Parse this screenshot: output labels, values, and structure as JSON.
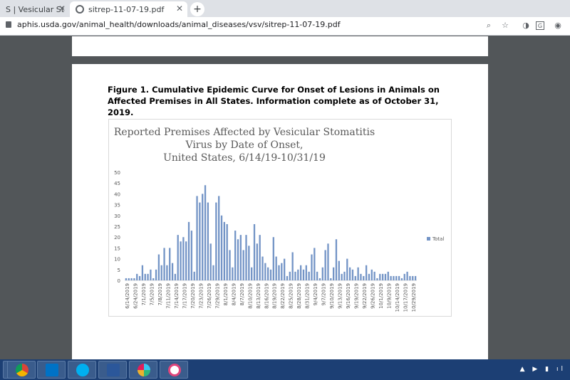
{
  "browser": {
    "tabs": [
      {
        "label": "S | Vesicular Stomatitis",
        "active": false
      },
      {
        "label": "sitrep-11-07-19.pdf",
        "active": true
      }
    ],
    "close_glyph": "✕",
    "new_tab_glyph": "+",
    "url": "aphis.usda.gov/animal_health/downloads/animal_diseases/vsv/sitrep-11-07-19.pdf",
    "toolbar_icons": [
      "zoom-icon",
      "star-icon",
      "extension-icon",
      "profile-icon",
      "menu-icon"
    ]
  },
  "document": {
    "figure_caption": "Figure 1.  Cumulative Epidemic Curve for Onset of Lesions in Animals on Affected Premises in All States.  Information complete as of October 31, 2019."
  },
  "chart_data": {
    "type": "bar",
    "title_lines": [
      "Reported Premises Affected by Vesicular Stomatitis",
      "Virus by Date of Onset,",
      "United States, 6/14/19-10/31/19"
    ],
    "series": [
      {
        "name": "Total",
        "color": "#7394c6"
      }
    ],
    "ylim": [
      0,
      50
    ],
    "yticks": [
      0,
      5,
      10,
      15,
      20,
      25,
      30,
      35,
      40,
      45,
      50
    ],
    "x_start": "2019-06-14",
    "x_end": "2019-10-31",
    "tick_labels": [
      "6/14/2019",
      "6/24/2019",
      "7/1/2019",
      "7/5/2019",
      "7/8/2019",
      "7/11/2019",
      "7/14/2019",
      "7/17/2019",
      "7/20/2019",
      "7/23/2019",
      "7/26/2019",
      "7/29/2019",
      "8/1/2019",
      "8/4/2019",
      "8/7/2019",
      "8/10/2019",
      "8/13/2019",
      "8/16/2019",
      "8/19/2019",
      "8/22/2019",
      "8/25/2019",
      "8/28/2019",
      "8/31/2019",
      "9/4/2019",
      "9/7/2019",
      "9/10/2019",
      "9/13/2019",
      "9/16/2019",
      "9/19/2019",
      "9/22/2019",
      "9/26/2019",
      "10/1/2019",
      "10/9/2019",
      "10/14/2019",
      "10/17/2019",
      "10/29/2019"
    ],
    "values": [
      1,
      1,
      1,
      1,
      3,
      2,
      7,
      3,
      3,
      5,
      1,
      5,
      12,
      7,
      15,
      7,
      15,
      8,
      3,
      21,
      18,
      20,
      18,
      27,
      23,
      4,
      39,
      36,
      40,
      44,
      36,
      17,
      7,
      36,
      39,
      30,
      27,
      26,
      14,
      6,
      23,
      19,
      21,
      14,
      21,
      16,
      6,
      26,
      17,
      21,
      11,
      8,
      6,
      5,
      20,
      11,
      7,
      8,
      10,
      2,
      4,
      13,
      4,
      5,
      7,
      5,
      7,
      4,
      12,
      15,
      4,
      1,
      6,
      14,
      17,
      1,
      6,
      19,
      9,
      3,
      4,
      10,
      6,
      5,
      2,
      6,
      3,
      2,
      7,
      3,
      5,
      4,
      1,
      3,
      3,
      3,
      4,
      2,
      2,
      2,
      2,
      1,
      3,
      4,
      2,
      2,
      2
    ]
  },
  "taskbar": {
    "apps": [
      "chrome-icon",
      "outlook-icon",
      "skype-icon",
      "word-icon",
      "slack-icon",
      "itunes-icon"
    ],
    "tray": "▲ ▶ ▮ ıl"
  }
}
